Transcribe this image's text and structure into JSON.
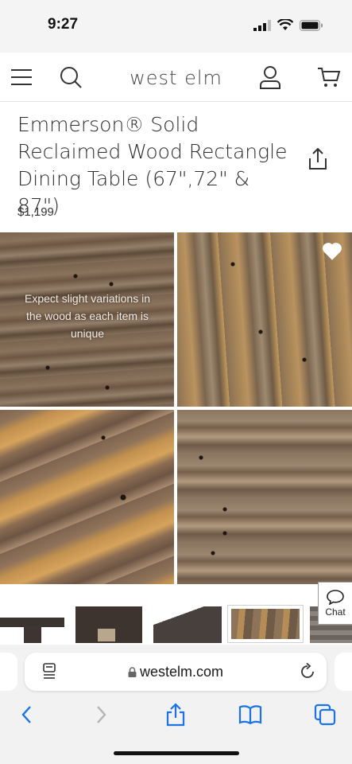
{
  "status_bar": {
    "time": "9:27"
  },
  "header": {
    "brand": "west elm",
    "icons": [
      "menu-icon",
      "search-icon",
      "account-icon",
      "cart-icon"
    ]
  },
  "product": {
    "title": "Emmerson® Solid Reclaimed Wood Rectangle Dining Table (67\",72\" & 87\")",
    "price": "$1,199"
  },
  "gallery": {
    "note": "Expect slight variations in the wood as each item is unique"
  },
  "chat": {
    "label": "Chat"
  },
  "browser": {
    "url": "westelm.com"
  },
  "colors": {
    "accent_blue": "#1a73e8",
    "brand_text": "#444444",
    "background": "#ffffff"
  }
}
